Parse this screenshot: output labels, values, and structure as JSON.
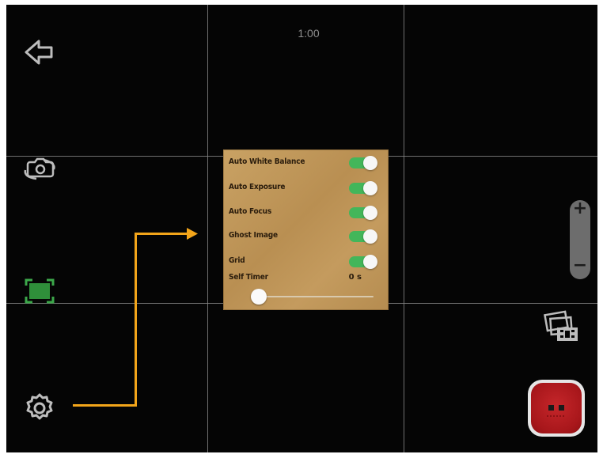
{
  "camera": {
    "timer_display": "1:00",
    "icons": {
      "back": "back-arrow-icon",
      "switch_camera": "switch-camera-icon",
      "focus_frame": "focus-frame-icon",
      "settings": "settings-gear-icon",
      "media_gallery": "media-gallery-icon",
      "record": "record-button-icon"
    },
    "zoom": {
      "plus": "+",
      "minus": "−"
    }
  },
  "settings_panel": {
    "rows": [
      {
        "label": "Auto White Balance",
        "on": true
      },
      {
        "label": "Auto Exposure",
        "on": true
      },
      {
        "label": "Auto Focus",
        "on": true
      },
      {
        "label": "Ghost Image",
        "on": true
      },
      {
        "label": "Grid",
        "on": true
      }
    ],
    "self_timer": {
      "label": "Self Timer",
      "value": "0 s",
      "level": 0
    }
  },
  "colors": {
    "toggle_on": "#43b65a",
    "focus_frame": "#2f8f3a",
    "annotation_arrow": "#f3a51a",
    "record": "#b51b1f",
    "panel": "#c29a5d"
  }
}
